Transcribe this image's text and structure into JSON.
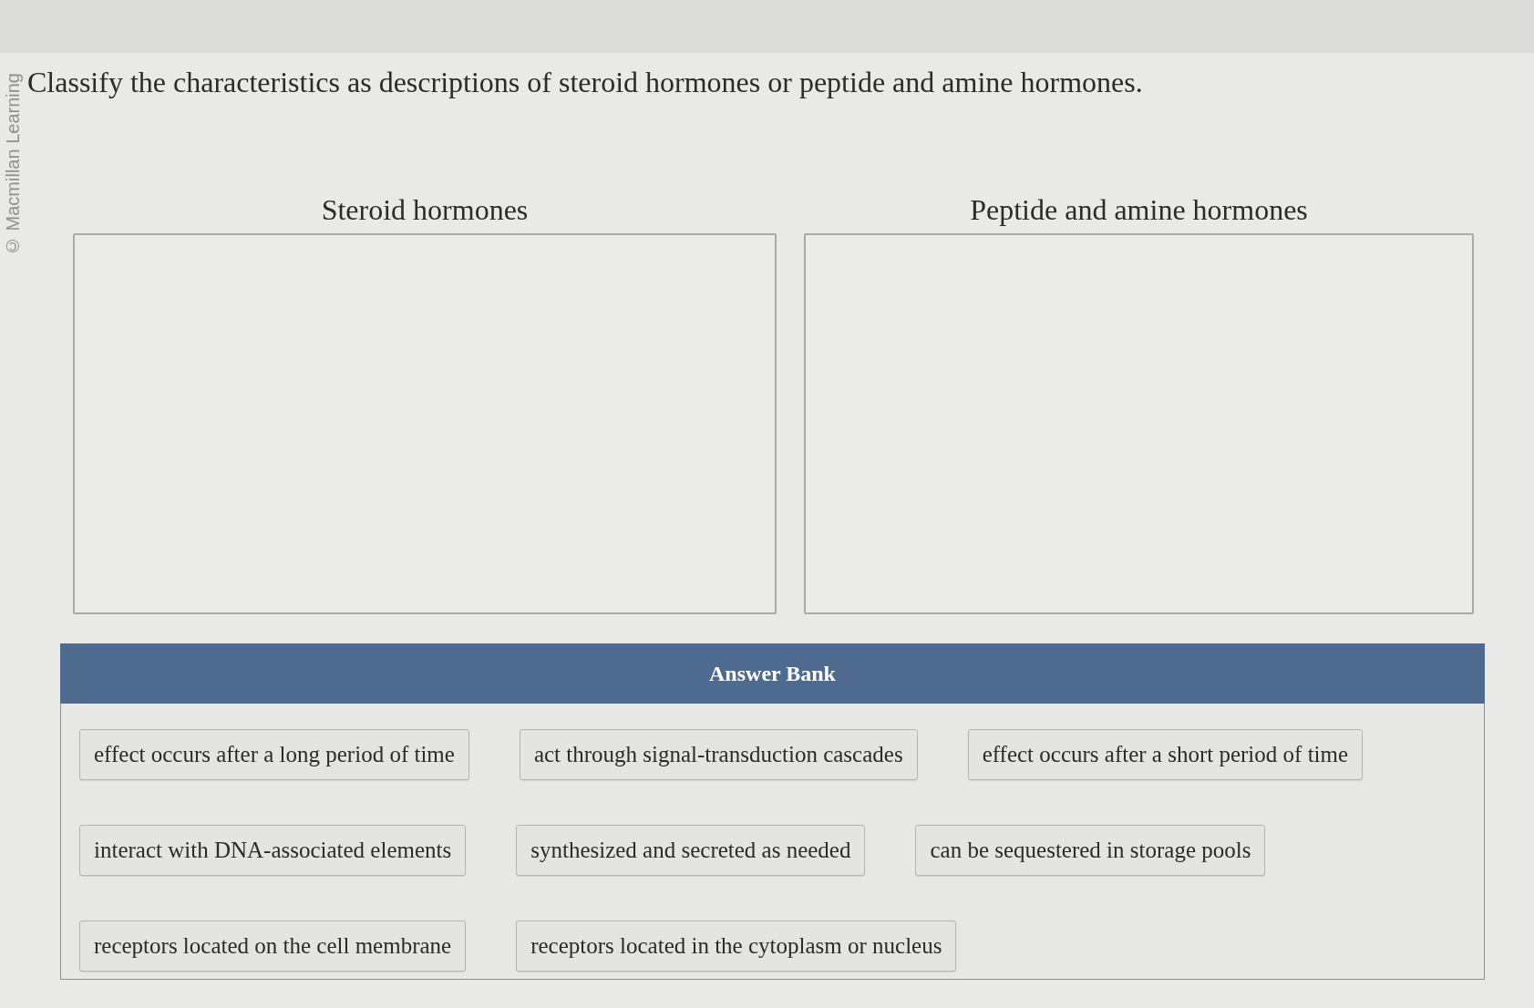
{
  "copyright": "© Macmillan Learning",
  "question": "Classify the characteristics as descriptions of steroid hormones or peptide and amine hormones.",
  "categories": [
    {
      "heading": "Steroid hormones"
    },
    {
      "heading": "Peptide and amine hormones"
    }
  ],
  "answer_bank": {
    "title": "Answer Bank",
    "items": [
      "effect occurs after a long period of time",
      "act through signal-transduction cascades",
      "effect occurs after a short period of time",
      "interact with DNA-associated elements",
      "synthesized and secreted as needed",
      "can be sequestered in storage pools",
      "receptors located on the cell membrane",
      "receptors located in the cytoplasm or nucleus"
    ]
  }
}
